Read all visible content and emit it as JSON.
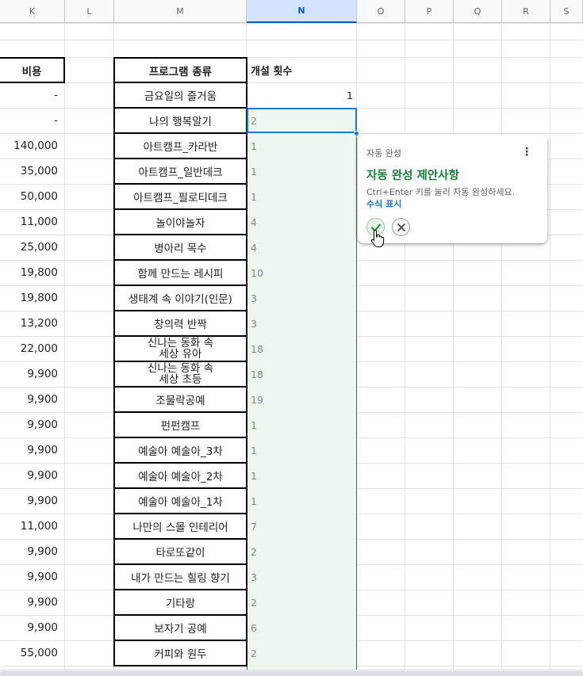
{
  "columns": [
    "K",
    "L",
    "M",
    "N",
    "O",
    "P",
    "Q",
    "R",
    "S"
  ],
  "selected_column": "N",
  "headers": {
    "cost": "비용",
    "program_type": "프로그램 종류",
    "session_count": "개설 횟수"
  },
  "rows": [
    {
      "cost": "-",
      "program": [
        "금요일의 즐거움"
      ],
      "count": "1"
    },
    {
      "cost": "-",
      "program": [
        "나의 행복알기"
      ],
      "count": "2"
    },
    {
      "cost": "140,000",
      "program": [
        "아트캠프_카라반"
      ],
      "count": "1"
    },
    {
      "cost": "35,000",
      "program": [
        "아트캠프_일반데크"
      ],
      "count": "1"
    },
    {
      "cost": "50,000",
      "program": [
        "아트캠프_필로티데크"
      ],
      "count": "1"
    },
    {
      "cost": "11,000",
      "program": [
        "놀이야놀자"
      ],
      "count": "4"
    },
    {
      "cost": "25,000",
      "program": [
        "병아리 목수"
      ],
      "count": "4"
    },
    {
      "cost": "19,800",
      "program": [
        "함께 만드는 레시피"
      ],
      "count": "10"
    },
    {
      "cost": "19,800",
      "program": [
        "생태계 속 이야기(인문)"
      ],
      "count": "3"
    },
    {
      "cost": "13,200",
      "program": [
        "창의력 반짝"
      ],
      "count": "3"
    },
    {
      "cost": "22,000",
      "program": [
        "신나는 동화 속",
        "세상 유아"
      ],
      "count": "18"
    },
    {
      "cost": "9,900",
      "program": [
        "신나는 동화 속",
        "세상 초등"
      ],
      "count": "18"
    },
    {
      "cost": "9,900",
      "program": [
        "조물락공예"
      ],
      "count": "19"
    },
    {
      "cost": "9,900",
      "program": [
        "펀펀캠프"
      ],
      "count": "1"
    },
    {
      "cost": "9,900",
      "program": [
        "예술아 예술아_3차"
      ],
      "count": "1"
    },
    {
      "cost": "9,900",
      "program": [
        "예술아 예술아_2차"
      ],
      "count": "1"
    },
    {
      "cost": "9,900",
      "program": [
        "예술아 예술아_1차"
      ],
      "count": "1"
    },
    {
      "cost": "11,000",
      "program": [
        "나만의 스몰 인테리어"
      ],
      "count": "7"
    },
    {
      "cost": "9,900",
      "program": [
        "타로또같이"
      ],
      "count": "2"
    },
    {
      "cost": "9,900",
      "program": [
        "내가 만드는 힐링 향기"
      ],
      "count": "3"
    },
    {
      "cost": "9,900",
      "program": [
        "기타랑"
      ],
      "count": "2"
    },
    {
      "cost": "9,900",
      "program": [
        "보자기 공예"
      ],
      "count": "6"
    },
    {
      "cost": "55,000",
      "program": [
        "커피와 원두"
      ],
      "count": "2"
    }
  ],
  "autocomplete": {
    "title": "자동 완성",
    "heading": "자동 완성 제안사항",
    "description": "Ctrl+Enter 키를 눌러 자동 완성하세요.",
    "link": "수식 표시",
    "accept_icon": "check-icon",
    "reject_icon": "close-icon",
    "more_icon": "more-vert-icon"
  },
  "colors": {
    "accent_green": "#188038",
    "selection_blue": "#1a73e8",
    "suggest_fill": "#eef7ee"
  }
}
